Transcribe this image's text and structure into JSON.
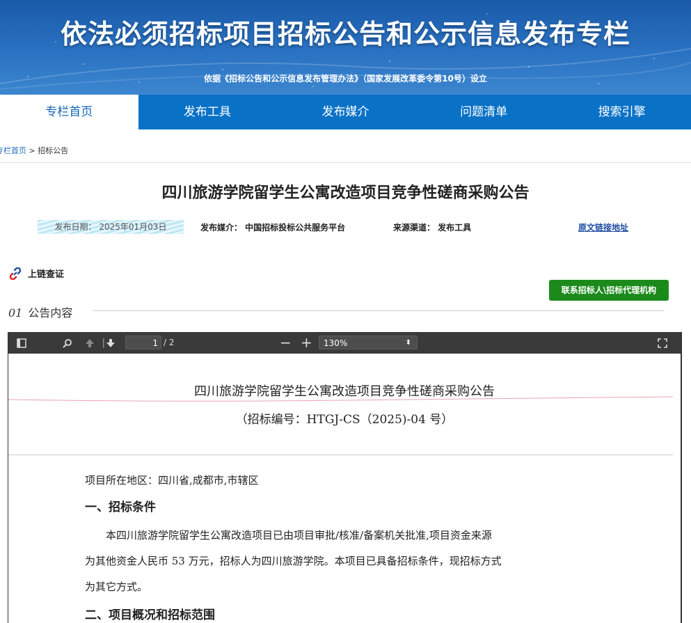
{
  "banner": {
    "title": "依法必须招标项目招标公告和公示信息发布专栏",
    "subtitle": "依据《招标公告和公示信息发布管理办法》（国家发展改革委令第10号）设立"
  },
  "nav": [
    {
      "label": "专栏首页",
      "active": true
    },
    {
      "label": "发布工具"
    },
    {
      "label": "发布媒介"
    },
    {
      "label": "问题清单"
    },
    {
      "label": "搜索引擎"
    }
  ],
  "breadcrumb": {
    "home": "专栏首页",
    "sep": " > ",
    "current": "招标公告"
  },
  "article": {
    "title": "四川旅游学院留学生公寓改造项目竞争性磋商采购公告",
    "publish_date": "发布日期：  2025年01月03日",
    "media": "发布媒介：  中国招标投标公共服务平台",
    "source": "来源渠道：  发布工具",
    "original_link": "原文链接地址"
  },
  "chain": {
    "label": "上链查证",
    "icon": "link-icon"
  },
  "contact_button": "联系招标人\\招标代理机构",
  "section": {
    "num": "01",
    "label": "公告内容"
  },
  "pdf_toolbar": {
    "page": "1",
    "page_count": "/ 2",
    "zoom": "130%",
    "icons": [
      "sidebar-toggle-icon",
      "search-icon",
      "prev-page-icon",
      "next-page-icon",
      "zoom-out-icon",
      "zoom-in-icon",
      "fullscreen-icon"
    ]
  },
  "doc": {
    "title": "四川旅游学院留学生公寓改造项目竞争性磋商采购公告",
    "number": "（招标编号：HTGJ-CS（2025)-04 号）",
    "location": "项目所在地区：四川省,成都市,市辖区",
    "h1": "一、招标条件",
    "p1_l1": "本四川旅游学院留学生公寓改造项目已由项目审批/核准/备案机关批准,项目资金来源",
    "p1_l2": "为其他资金人民币 53 万元，招标人为四川旅游学院。本项目已具备招标条件，现招标方式",
    "p1_l3": "为其它方式。",
    "h2": "二、项目概况和招标范围"
  },
  "colors": {
    "nav_bg": "#0a72c6",
    "banner_bg": "#2a72c2",
    "contact_btn": "#1b8a1b",
    "link": "#1f4ea3"
  }
}
